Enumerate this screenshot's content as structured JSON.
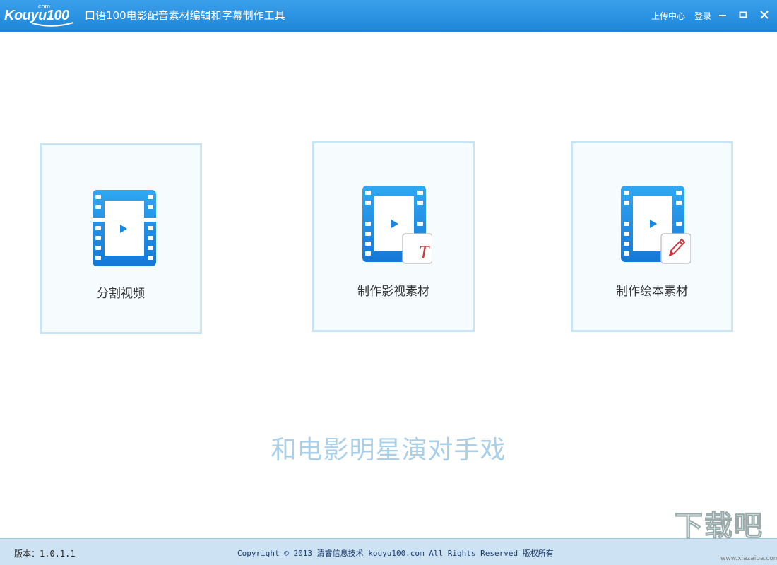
{
  "titlebar": {
    "logo_text": "Kouyu100",
    "logo_com": "com",
    "title": "口语100电影配音素材编辑和字幕制作工具",
    "upload_center": "上传中心",
    "login": "登录"
  },
  "cards": [
    {
      "label": "分割视频",
      "badge": "none"
    },
    {
      "label": "制作影视素材",
      "badge": "text-T"
    },
    {
      "label": "制作绘本素材",
      "badge": "pencil"
    }
  ],
  "badge_text": "T",
  "slogan": "和电影明星演对手戏",
  "footer": {
    "version": "版本：1.0.1.1",
    "copyright": "Copyright © 2013 清睿信息技术 kouyu100.com All Rights Reserved 版权所有"
  },
  "watermark": {
    "text": "下载吧",
    "sub": "www.xiazaiba.com"
  },
  "colors": {
    "titlebar": "#2592e0",
    "card_border": "#c9e4f3",
    "card_bg": "#f6fbfe",
    "film_blue": "#1a90e8",
    "slogan": "#a9cfe9",
    "footer_bg": "#cde3f3"
  }
}
